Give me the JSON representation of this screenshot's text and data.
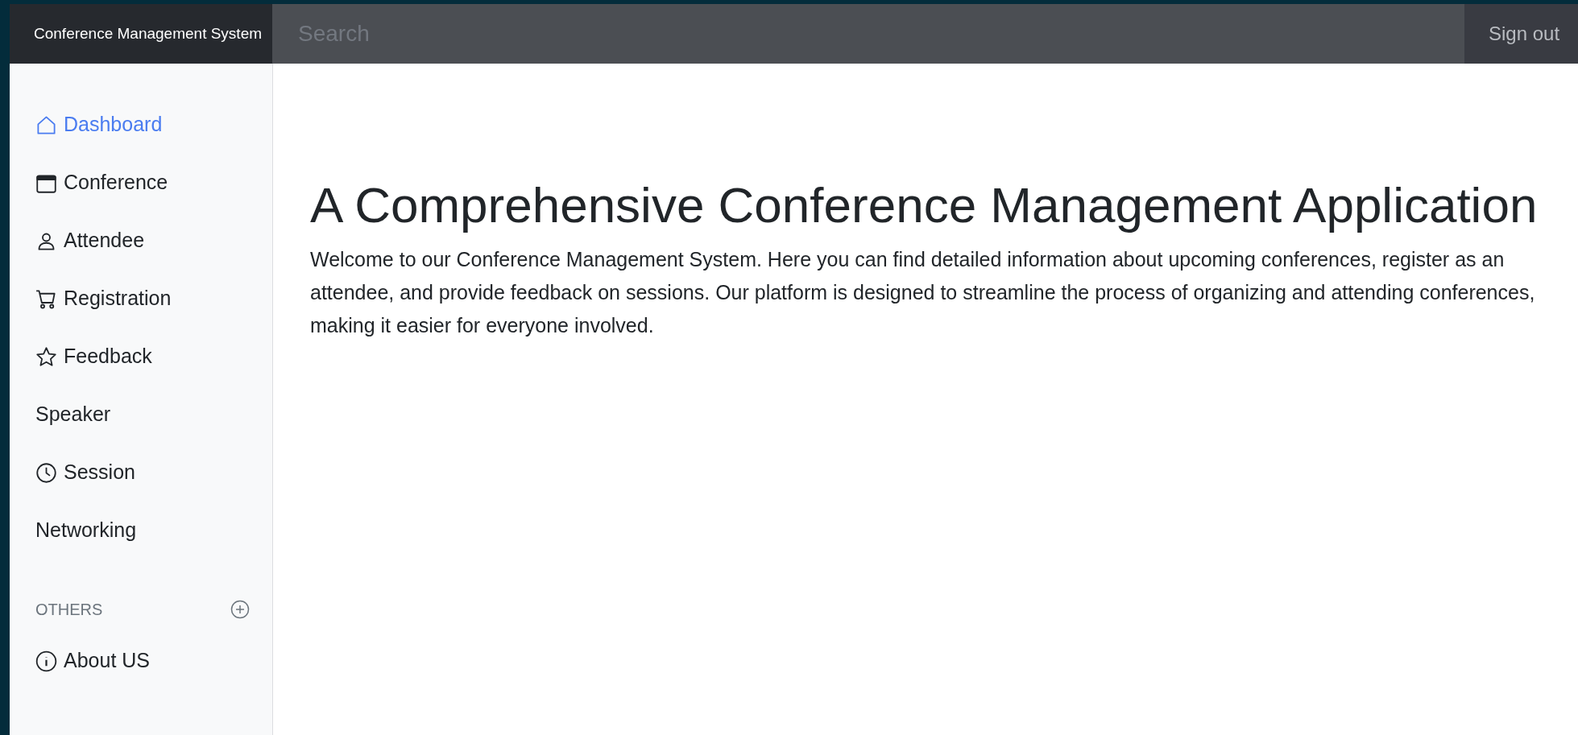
{
  "brand": "Conference Management System",
  "search": {
    "placeholder": "Search"
  },
  "sign_out": "Sign out",
  "sidebar": {
    "items": [
      {
        "label": "Dashboard",
        "selected": true
      },
      {
        "label": "Conference",
        "selected": false
      },
      {
        "label": "Attendee",
        "selected": false
      },
      {
        "label": "Registration",
        "selected": false
      },
      {
        "label": "Feedback",
        "selected": false
      },
      {
        "label": "Speaker",
        "selected": false
      },
      {
        "label": "Session",
        "selected": false
      },
      {
        "label": "Networking",
        "selected": false
      }
    ],
    "section_heading": "OTHERS",
    "others": [
      {
        "label": "About US",
        "selected": false
      }
    ]
  },
  "main": {
    "title": "A Comprehensive Conference Management Application",
    "text": "Welcome to our Conference Management System. Here you can find detailed information about upcoming conferences, register as an attendee, and provide feedback on sessions. Our platform is designed to streamline the process of organizing and attending conferences, making it easier for everyone involved."
  }
}
